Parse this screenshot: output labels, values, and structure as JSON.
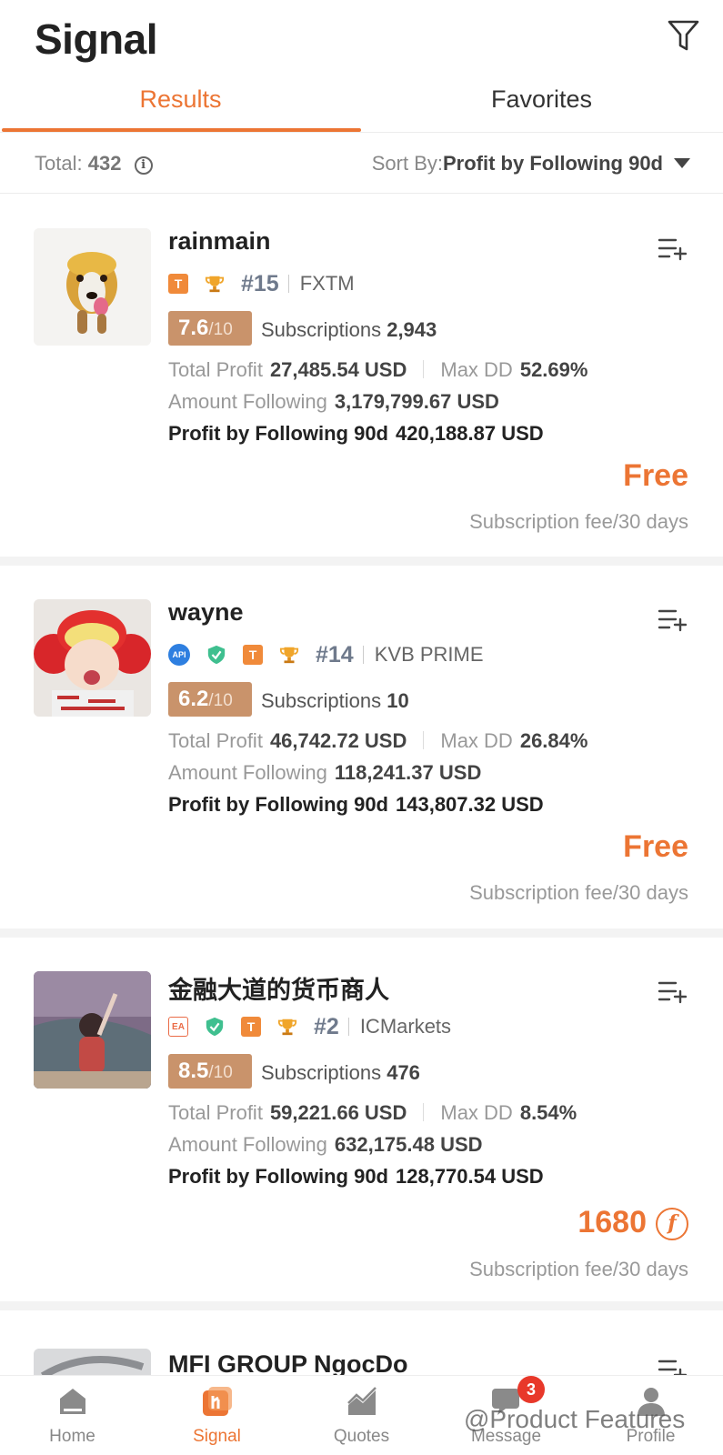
{
  "header": {
    "title": "Signal"
  },
  "tabs": [
    {
      "label": "Results",
      "active": true
    },
    {
      "label": "Favorites",
      "active": false
    }
  ],
  "toolbar": {
    "total_label": "Total:",
    "total_value": "432",
    "sort_label": "Sort By:",
    "sort_value": "Profit by Following 90d"
  },
  "labels": {
    "subscriptions": "Subscriptions",
    "total_profit": "Total Profit",
    "max_dd": "Max DD",
    "amount_following": "Amount Following",
    "profit_90d": "Profit by Following 90d",
    "fee_period": "Subscription fee/30 days",
    "score_out_of": "/10"
  },
  "signals": [
    {
      "name": "rainmain",
      "badges": [
        "T",
        "trophy"
      ],
      "rank": "#15",
      "broker": "FXTM",
      "score": "7.6",
      "subscriptions": "2,943",
      "total_profit": "27,485.54 USD",
      "max_dd": "52.69%",
      "amount_following": "3,179,799.67 USD",
      "profit_90d": "420,188.87 USD",
      "price": "Free"
    },
    {
      "name": "wayne",
      "badges": [
        "API",
        "shield",
        "T",
        "trophy"
      ],
      "rank": "#14",
      "broker": "KVB PRIME",
      "score": "6.2",
      "subscriptions": "10",
      "total_profit": "46,742.72 USD",
      "max_dd": "26.84%",
      "amount_following": "118,241.37 USD",
      "profit_90d": "143,807.32 USD",
      "price": "Free"
    },
    {
      "name": "金融大道的货币商人",
      "badges": [
        "EA",
        "shield",
        "T",
        "trophy"
      ],
      "rank": "#2",
      "broker": "ICMarkets",
      "score": "8.5",
      "subscriptions": "476",
      "total_profit": "59,221.66 USD",
      "max_dd": "8.54%",
      "amount_following": "632,175.48 USD",
      "profit_90d": "128,770.54 USD",
      "price": "1680",
      "price_coin_icon": "coin-icon"
    },
    {
      "name": "MFI GROUP NgocDo"
    }
  ],
  "badge_text": {
    "t": "T",
    "ea": "EA",
    "api": "API",
    "coin": "f"
  },
  "nav": [
    {
      "label": "Home",
      "icon": "home-icon"
    },
    {
      "label": "Signal",
      "icon": "signal-icon",
      "active": true
    },
    {
      "label": "Quotes",
      "icon": "quotes-icon"
    },
    {
      "label": "Message",
      "icon": "message-icon",
      "badge": "3"
    },
    {
      "label": "Profile",
      "icon": "profile-icon"
    }
  ],
  "watermark": "@Product Features",
  "colors": {
    "accent": "#ec7534",
    "score_bg": "#c9936b",
    "badge_red": "#e8382a",
    "shield": "#3fbf8f"
  }
}
